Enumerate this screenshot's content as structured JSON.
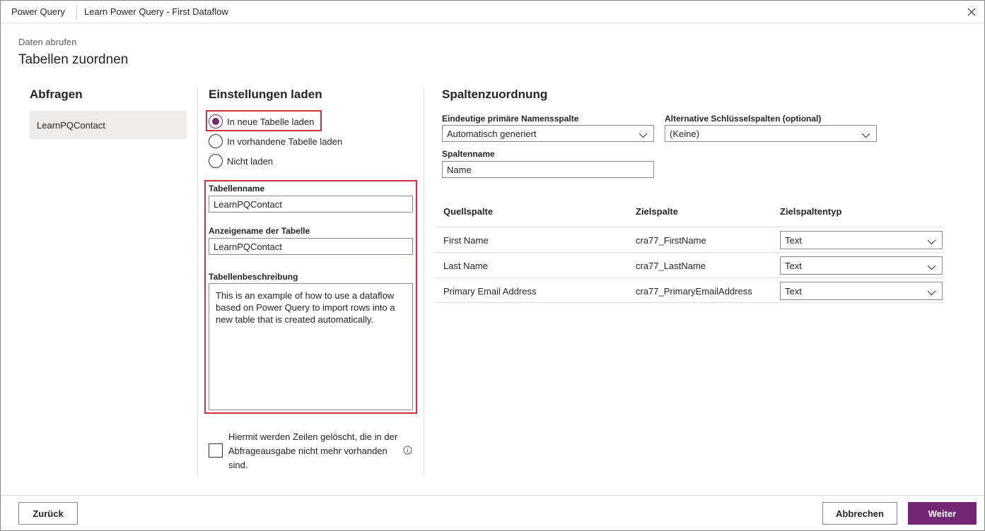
{
  "titlebar": {
    "app_name": "Power Query",
    "document_title": "Learn Power Query - First Dataflow"
  },
  "breadcrumb": "Daten abrufen",
  "page_title": "Tabellen zuordnen",
  "queries": {
    "heading": "Abfragen",
    "items": [
      "LearnPQContact"
    ]
  },
  "load_settings": {
    "heading": "Einstellungen laden",
    "options": [
      {
        "label": "In neue Tabelle laden",
        "checked": true
      },
      {
        "label": "In vorhandene Tabelle laden",
        "checked": false
      },
      {
        "label": "Nicht laden",
        "checked": false
      }
    ],
    "table_name_label": "Tabellenname",
    "table_name_value": "LearnPQContact",
    "display_name_label": "Anzeigename der Tabelle",
    "display_name_value": "LearnPQContact",
    "description_label": "Tabellenbeschreibung",
    "description_value": "This is an example of how to use a dataflow based on Power Query to import rows into a new table that is created automatically.",
    "delete_rows_label": "Hiermit werden Zeilen gelöscht, die in der Abfrageausgabe nicht mehr vorhanden sind.",
    "delete_rows_checked": false
  },
  "column_mapping": {
    "heading": "Spaltenzuordnung",
    "primary_name_label": "Eindeutige primäre Namensspalte",
    "primary_name_value": "Automatisch generiert",
    "alt_keys_label": "Alternative Schlüsselspalten (optional)",
    "alt_keys_value": "(Keine)",
    "column_name_label": "Spaltenname",
    "column_name_value": "Name",
    "headers": [
      "Quellspalte",
      "Zielspalte",
      "Zielspaltentyp"
    ],
    "rows": [
      {
        "source": "First Name",
        "target": "cra77_FirstName",
        "type": "Text"
      },
      {
        "source": "Last Name",
        "target": "cra77_LastName",
        "type": "Text"
      },
      {
        "source": "Primary Email Address",
        "target": "cra77_PrimaryEmailAddress",
        "type": "Text"
      }
    ]
  },
  "footer": {
    "back_label": "Zurück",
    "cancel_label": "Abbrechen",
    "next_label": "Weiter"
  },
  "colors": {
    "accent": "#742774",
    "highlight": "#d13438"
  }
}
